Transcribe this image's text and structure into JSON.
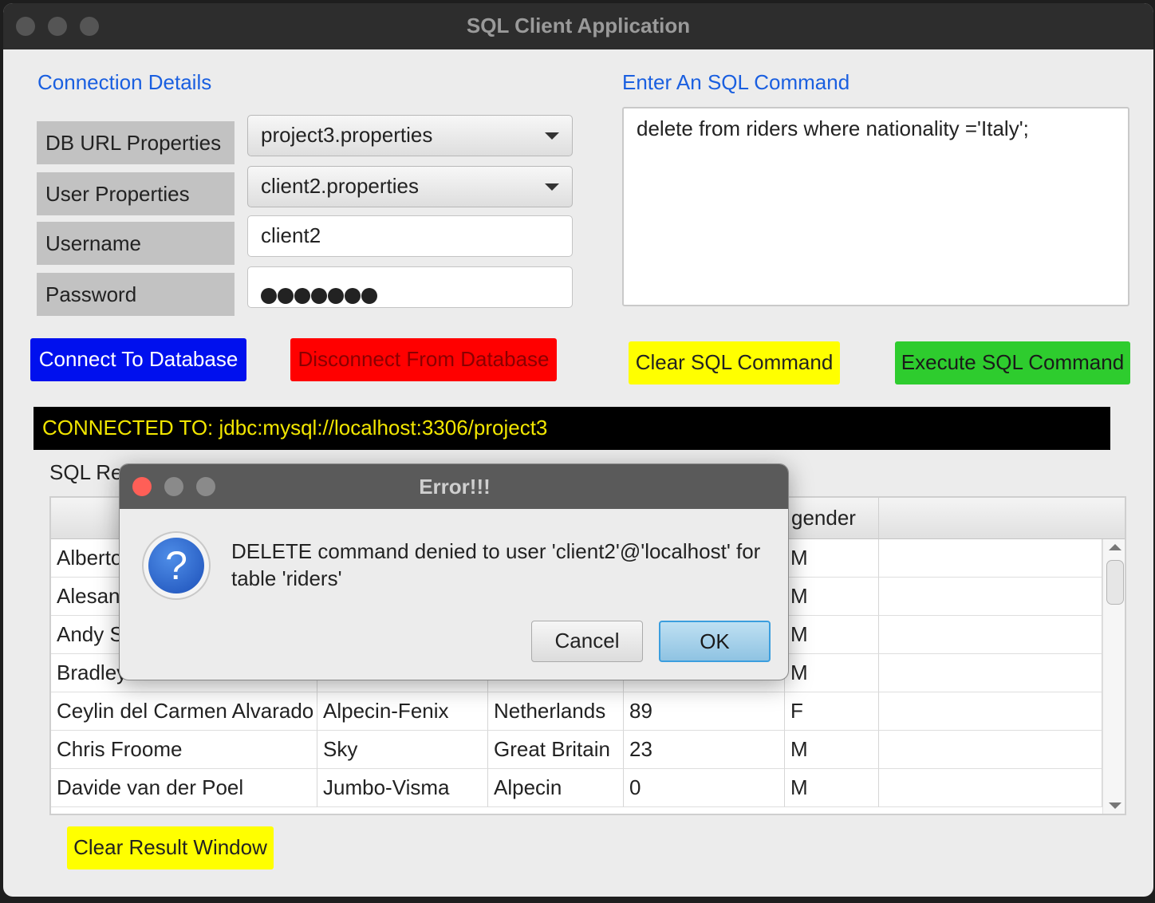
{
  "window": {
    "title": "SQL Client Application"
  },
  "connection": {
    "section_title": "Connection Details",
    "labels": {
      "db_url": "DB URL Properties",
      "user": "User Properties",
      "username": "Username",
      "password": "Password"
    },
    "db_url_value": "project3.properties",
    "user_value": "client2.properties",
    "username_value": "client2",
    "password_length": 7
  },
  "sql": {
    "section_title": "Enter An SQL Command",
    "command_text": "delete from riders where nationality ='Italy';"
  },
  "buttons": {
    "connect": "Connect To Database",
    "disconnect": "Disconnect From Database",
    "clear_sql": "Clear SQL Command",
    "execute_sql": "Execute SQL Command",
    "clear_result": "Clear Result Window"
  },
  "colors": {
    "connect_bg": "#0010ee",
    "disconnect_bg": "#ff0000",
    "clear_bg": "#ffff00",
    "execute_bg": "#2ecc2e",
    "status_text": "#f2e600"
  },
  "status": {
    "text": "CONNECTED TO: jdbc:mysql://localhost:3306/project3"
  },
  "results": {
    "title": "SQL Res",
    "columns": [
      "",
      "",
      "",
      "",
      "gender",
      ""
    ],
    "rows": [
      [
        "Alberto",
        "",
        "",
        "",
        "M",
        ""
      ],
      [
        "Alesand",
        "",
        "",
        "",
        "M",
        ""
      ],
      [
        "Andy S",
        "",
        "",
        "",
        "M",
        ""
      ],
      [
        "Bradley",
        "",
        "",
        "",
        "M",
        ""
      ],
      [
        "Ceylin del Carmen Alvarado",
        "Alpecin-Fenix",
        "Netherlands",
        "89",
        "F",
        ""
      ],
      [
        "Chris Froome",
        "Sky",
        "Great Britain",
        "23",
        "M",
        ""
      ],
      [
        "Davide van der Poel",
        "Jumbo-Visma",
        "Alpecin",
        "0",
        "M",
        ""
      ]
    ]
  },
  "dialog": {
    "title": "Error!!!",
    "icon": "question-icon",
    "icon_glyph": "?",
    "message_line1": "DELETE command denied to user 'client2'@'localhost' for",
    "message_line2": "table 'riders'",
    "cancel_label": "Cancel",
    "ok_label": "OK"
  }
}
